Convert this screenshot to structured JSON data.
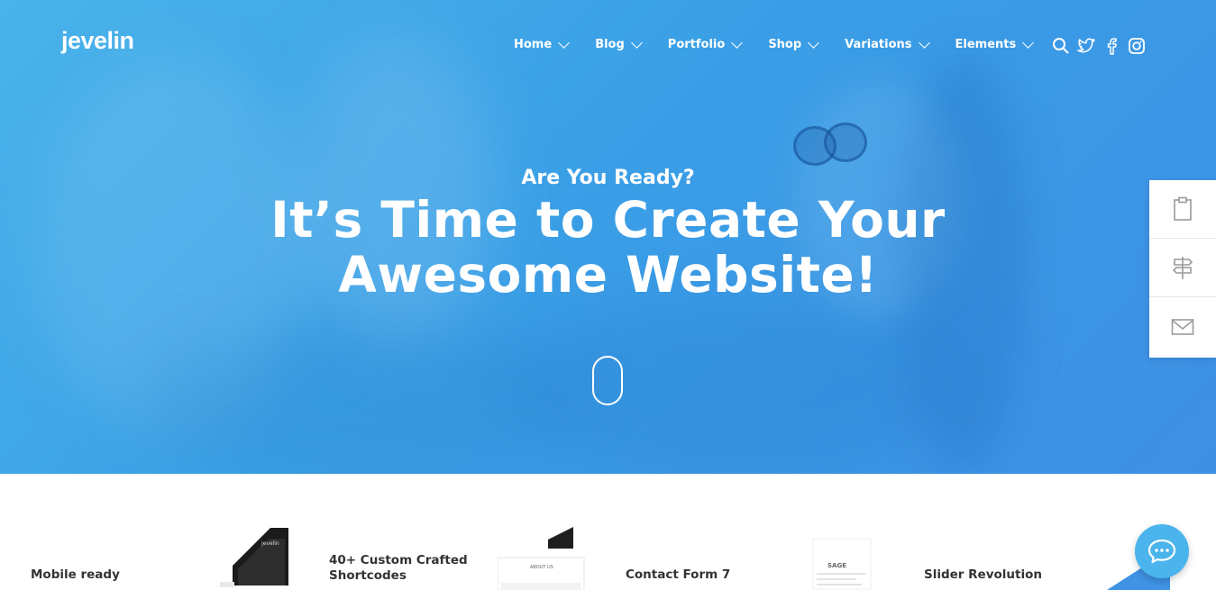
{
  "header": {
    "logo": "jevelin",
    "nav": [
      {
        "label": "Home"
      },
      {
        "label": "Blog"
      },
      {
        "label": "Portfolio"
      },
      {
        "label": "Shop"
      },
      {
        "label": "Variations"
      },
      {
        "label": "Elements"
      }
    ],
    "icons": [
      "search-icon",
      "twitter-icon",
      "facebook-icon",
      "instagram-icon"
    ]
  },
  "hero": {
    "eyebrow": "Are You Ready?",
    "headline_line1": "It’s Time to Create Your",
    "headline_line2": "Awesome Website!",
    "scroll_indicator": "mouse-icon"
  },
  "side_panel": [
    "clipboard-icon",
    "signpost-icon",
    "mail-icon"
  ],
  "features": [
    {
      "label": "Mobile ready"
    },
    {
      "label_line1": "40+ Custom Crafted",
      "label_line2": "Shortcodes"
    },
    {
      "label": "Contact Form 7"
    },
    {
      "label": "Slider Revolution"
    }
  ],
  "mockups": {
    "phone_logo": "jevelin",
    "about_tab": "ABOUT US",
    "message_heading": "SAGE"
  },
  "chat_button": "chat-bubble-icon",
  "colors": {
    "hero_blue": "#3d9fe6",
    "accent": "#4bb4ec",
    "text_dark": "#333333"
  }
}
